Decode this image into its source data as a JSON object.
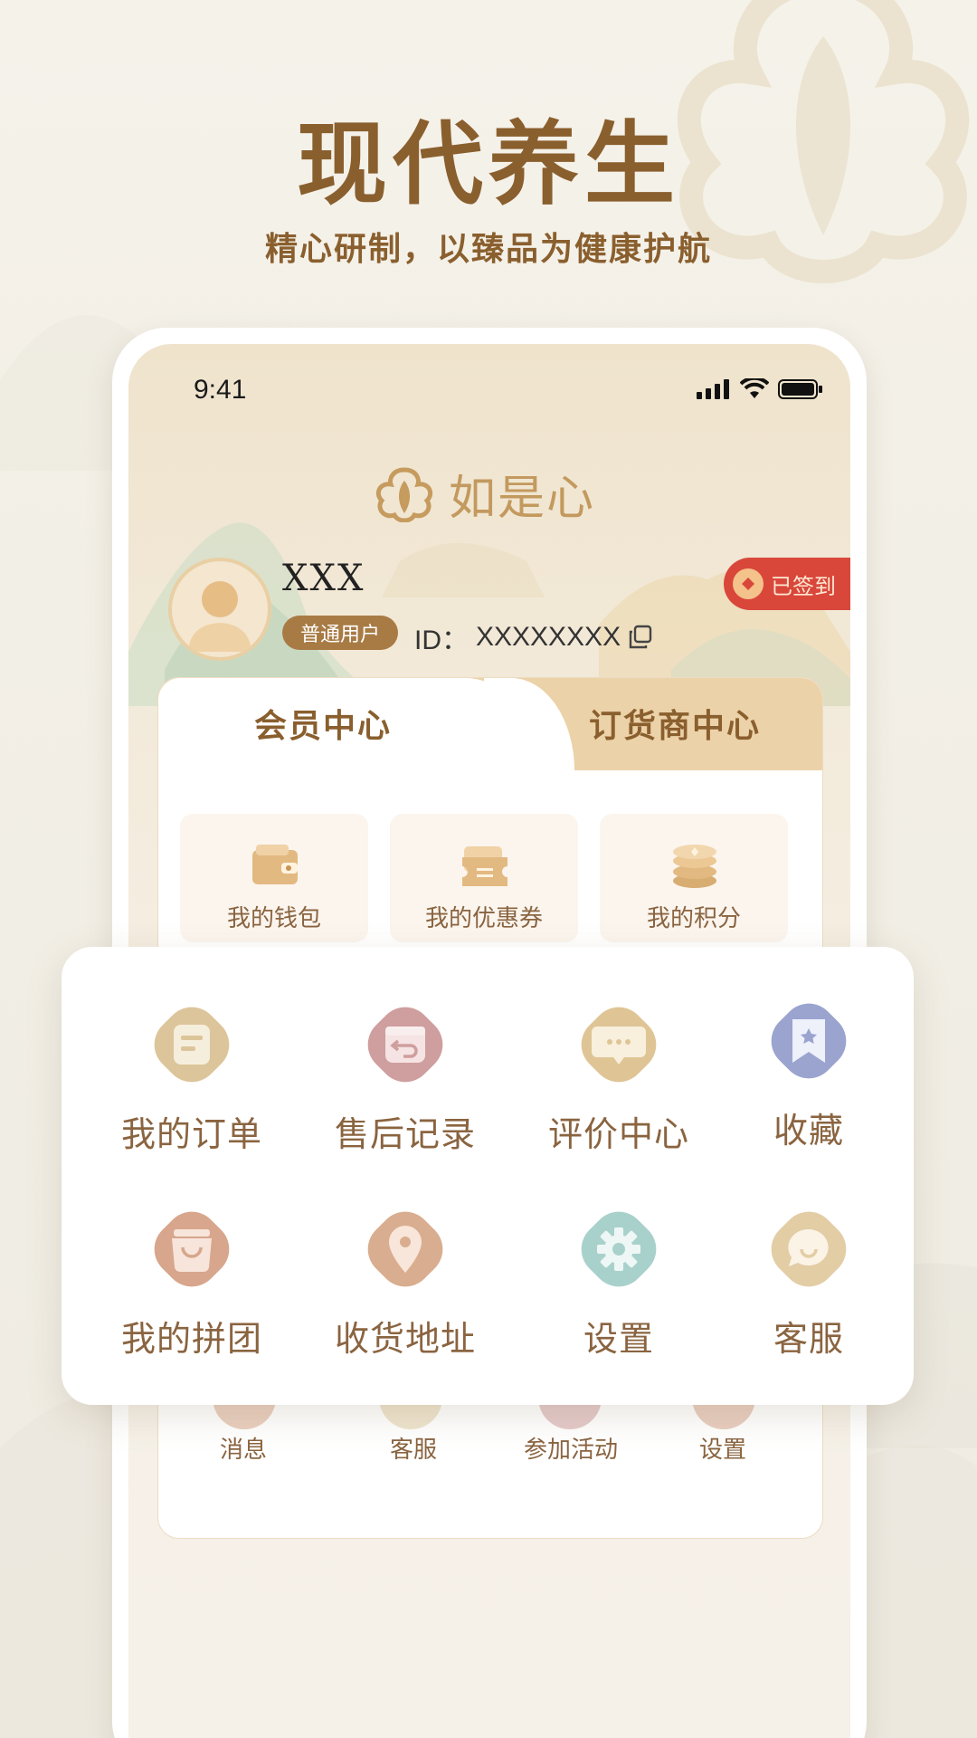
{
  "promo": {
    "headline": "现代养生",
    "subline": "精心研制，以臻品为健康护航"
  },
  "status_bar": {
    "time": "9:41"
  },
  "app": {
    "logo_text": "如是心"
  },
  "profile": {
    "username": "XXX",
    "badge": "普通用户",
    "id_label": "ID：",
    "id_value": "XXXXXXXX",
    "checkin_label": "已签到"
  },
  "tabs": [
    {
      "label": "会员中心",
      "active": true
    },
    {
      "label": "订货商中心",
      "active": false
    }
  ],
  "assets": [
    {
      "label": "我的钱包",
      "icon": "wallet-icon"
    },
    {
      "label": "我的优惠券",
      "icon": "coupon-icon"
    },
    {
      "label": "我的积分",
      "icon": "coins-icon"
    }
  ],
  "menu": [
    {
      "label": "我的订单",
      "icon": "order-icon",
      "color": "#dcc59a"
    },
    {
      "label": "售后记录",
      "icon": "return-icon",
      "color": "#cf9e9e"
    },
    {
      "label": "评价中心",
      "icon": "comment-icon",
      "color": "#dfc595"
    },
    {
      "label": "收藏",
      "icon": "bookmark-star-icon",
      "color": "#9aa4cf"
    },
    {
      "label": "我的拼团",
      "icon": "shopping-bag-icon",
      "color": "#d7a68c"
    },
    {
      "label": "收货地址",
      "icon": "location-pin-icon",
      "color": "#d9ad8f"
    },
    {
      "label": "设置",
      "icon": "gear-icon",
      "color": "#a9d1cc"
    },
    {
      "label": "客服",
      "icon": "chat-bubble-icon",
      "color": "#e2cda5"
    }
  ],
  "bottom_row": [
    {
      "label": "消息"
    },
    {
      "label": "客服"
    },
    {
      "label": "参加活动"
    },
    {
      "label": "设置"
    }
  ]
}
